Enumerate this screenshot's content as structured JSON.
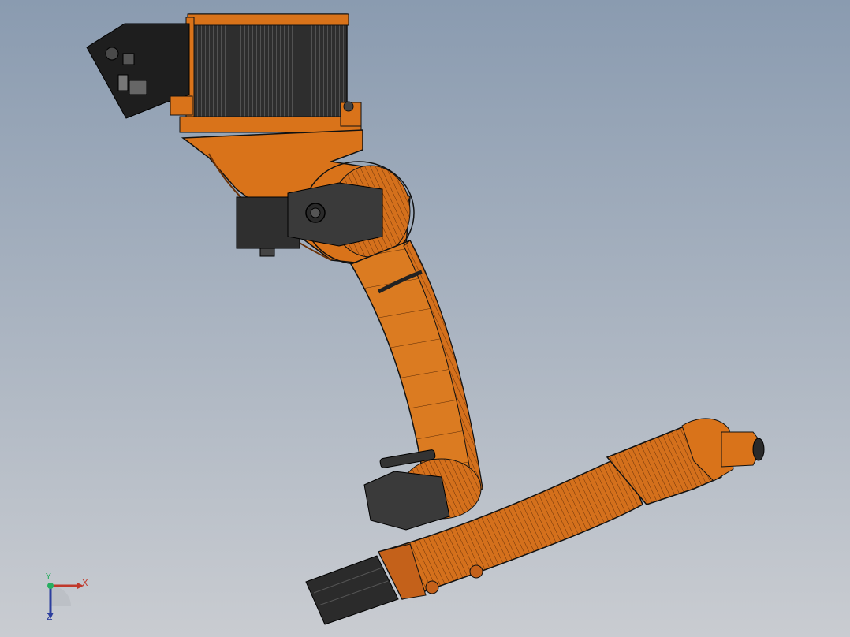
{
  "viewport": {
    "background_top": "#8a9bb0",
    "background_bottom": "#c9ccd1"
  },
  "model": {
    "body_color": "#d9731a",
    "dark_color": "#3a3a3a",
    "edge_color": "#1a1a1a"
  },
  "triad": {
    "x_label": "X",
    "y_label": "Y",
    "z_label": "Z",
    "x_color": "#c0392b",
    "y_color": "#27ae60",
    "z_color": "#2c3e9e"
  }
}
